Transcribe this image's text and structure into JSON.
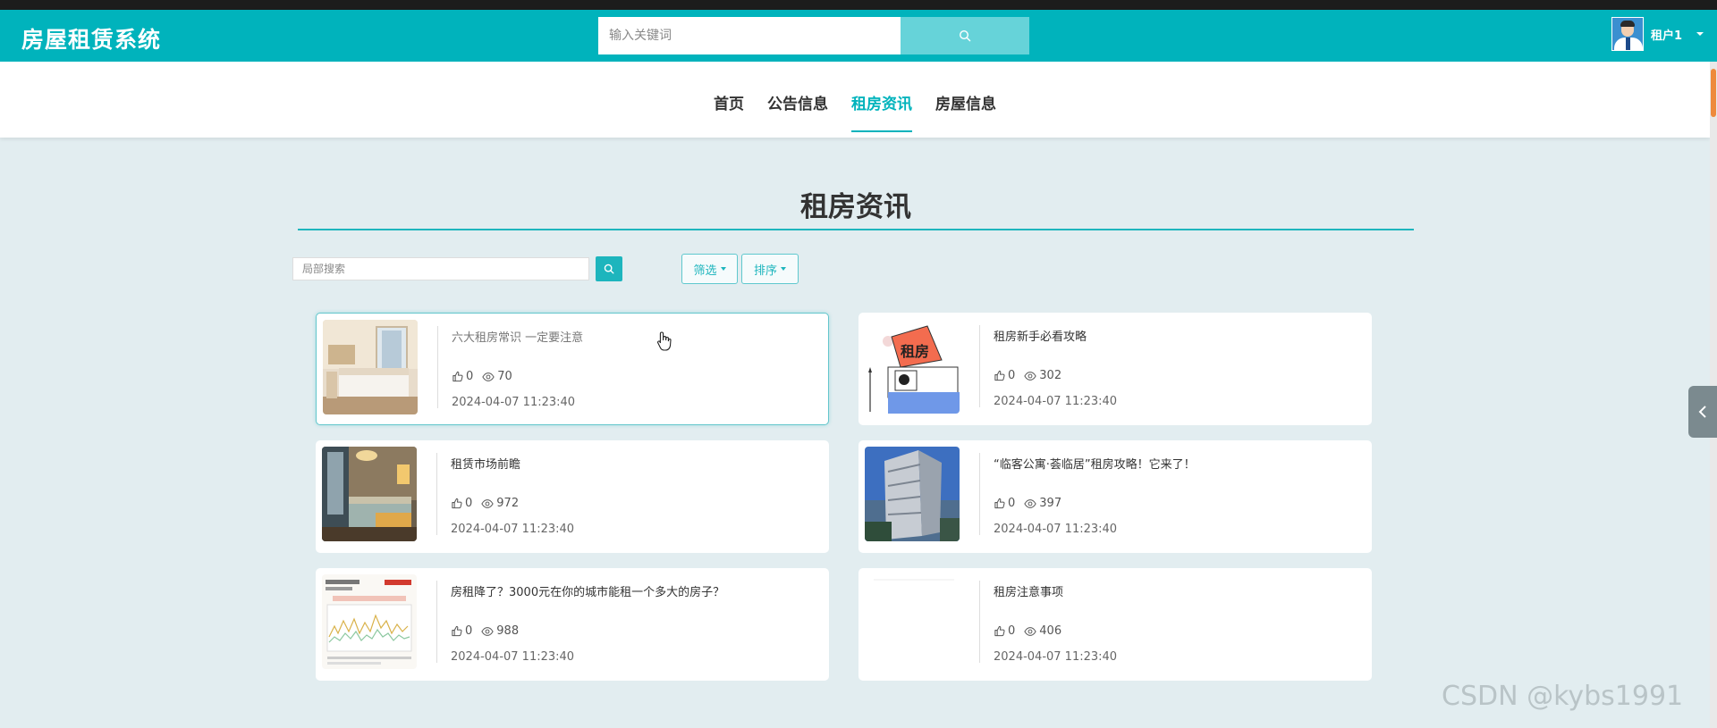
{
  "header": {
    "brand": "房屋租赁系统",
    "search_placeholder": "输入关键词",
    "username": "租户1",
    "accent": "#00b3bc"
  },
  "nav": {
    "items": [
      "首页",
      "公告信息",
      "租房资讯",
      "房屋信息"
    ],
    "active": "租房资讯"
  },
  "section": {
    "title": "租房资讯",
    "local_search_placeholder": "局部搜索",
    "filter_label": "筛选",
    "sort_label": "排序"
  },
  "cards": [
    {
      "title": "六大租房常识 一定要注意",
      "likes": "0",
      "views": "70",
      "date": "2024-04-07 11:23:40",
      "image": "bedroom-photo"
    },
    {
      "title": "租房新手必看攻略",
      "likes": "0",
      "views": "302",
      "date": "2024-04-07 11:23:40",
      "image": "rental-house-illustration",
      "image_text": "租房"
    },
    {
      "title": "租赁市场前瞻",
      "likes": "0",
      "views": "972",
      "date": "2024-04-07 11:23:40",
      "image": "hotel-room-photo"
    },
    {
      "title": "“临客公寓·荟临居”租房攻略！它来了！",
      "likes": "0",
      "views": "397",
      "date": "2024-04-07 11:23:40",
      "image": "apartment-building-photo"
    },
    {
      "title": "房租降了？3000元在你的城市能租一个多大的房子？",
      "likes": "0",
      "views": "988",
      "date": "2024-04-07 11:23:40",
      "image": "rent-chart-image"
    },
    {
      "title": "租房注意事项",
      "likes": "0",
      "views": "406",
      "date": "2024-04-07 11:23:40",
      "image": "blank-image"
    }
  ],
  "watermark": "CSDN @kybs1991"
}
